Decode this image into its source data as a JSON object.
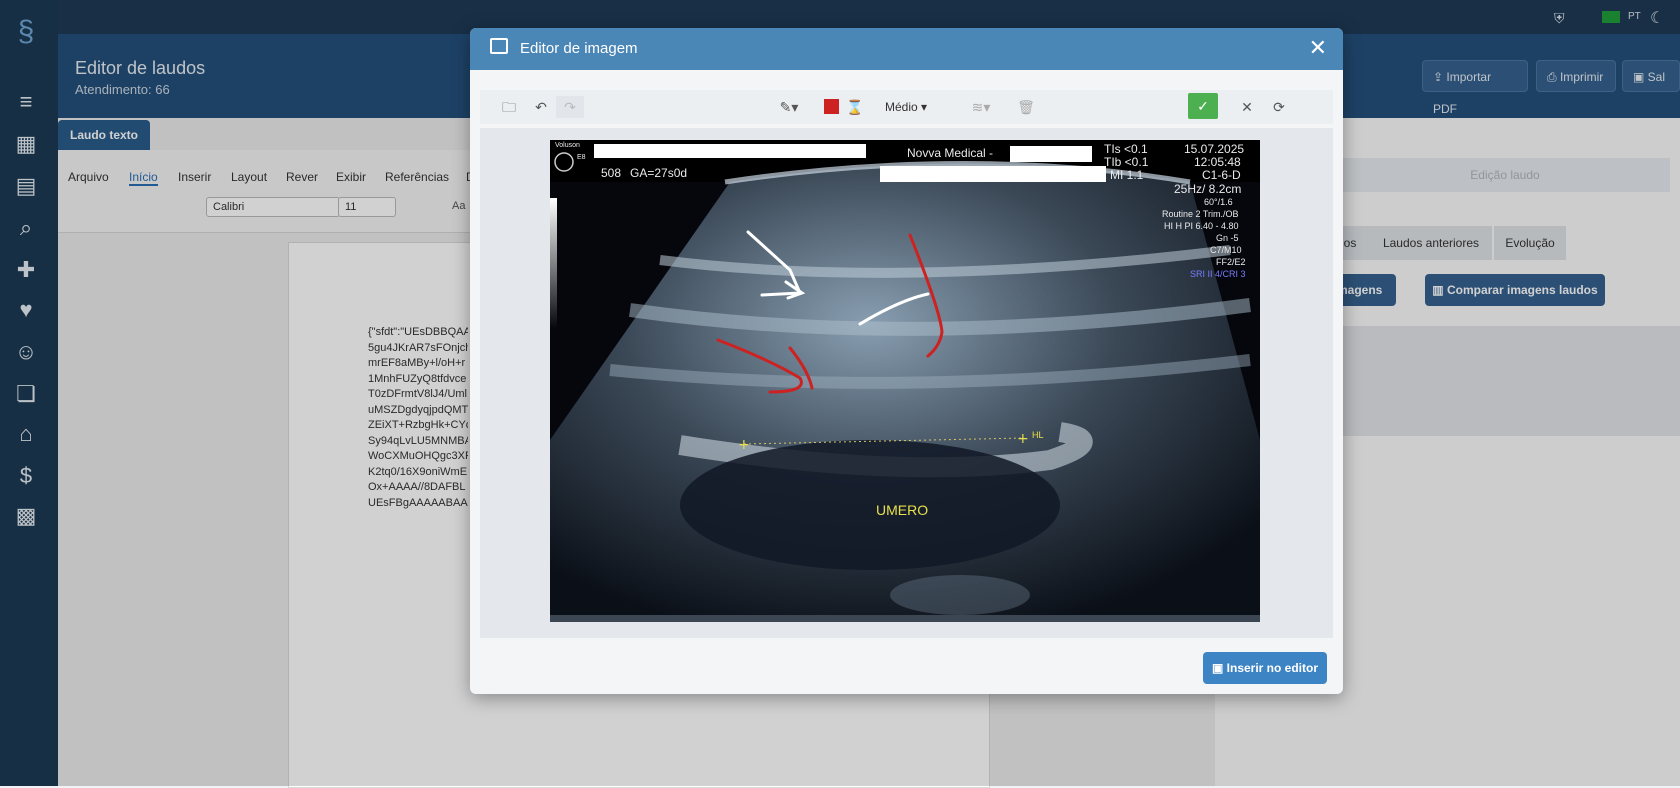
{
  "app": {
    "title": "Editor de laudos",
    "subtitle": "Atendimento: 66",
    "language": "PT",
    "buttons": {
      "import_pdf": "Importar PDF",
      "print": "Imprimir",
      "save": "Sal"
    }
  },
  "editor": {
    "tab_label": "Laudo texto",
    "ribbon_tabs": [
      "Arquivo",
      "Início",
      "Inserir",
      "Layout",
      "Rever",
      "Exibir",
      "Referências",
      "D"
    ],
    "font_name": "Calibri",
    "font_size": "11",
    "aa_label": "Aa",
    "doc_lines": [
      "{\"sfdt\":\"UEsDBBQAA",
      "5gu4JKrAR7sFOnjch",
      "mrEF8aMBy+l/oH+r",
      "1MnhFUZyQ8tfdvce",
      "T0zDFrmtV8lJ4/Uml",
      "uMSZDgdyqjpdQMT",
      "ZEiXT+RzbgHk+CYcI",
      "Sy94qLvLU5MNMBA",
      "WoCXMuOHQgc3XF",
      "K2tq0/16X9oniWmE",
      "Ox+AAAA//8DAFBL",
      "UEsFBgAAAAABAAE"
    ]
  },
  "right_panel": {
    "edit_label": "Edição laudo",
    "tabs": [
      "os",
      "Laudos anteriores",
      "Evolução"
    ],
    "buttons": {
      "images": "imagens",
      "compare": "Comparar imagens laudos"
    }
  },
  "modal": {
    "title": "Editor de imagem",
    "stroke_size": "Médio",
    "insert_label": "Inserir no editor",
    "accent": "#4a86b6",
    "pen_color": "#cc2222",
    "confirm_color": "#4caf50"
  },
  "ultrasound": {
    "clinic": "Novva Medical -",
    "patient_code": "508",
    "ga": "GA=27s0d",
    "tis": "TIs <0.1",
    "tib": "TIb <0.1",
    "mi": "MI  1.1",
    "date": "15.07.2025",
    "time": "12:05:48",
    "probe": "C1-6-D",
    "freq_depth": "25Hz/ 8.2cm",
    "angle": "60°/1.6",
    "preset": "Routine 2 Trim./OB",
    "mode": "HI H PI 6.40 - 4.80",
    "gain": "Gn  -5",
    "c_m": "C7/M10",
    "ff": "FF2/E2",
    "sri": "SRI II 4/CRI 3",
    "voluson": "Voluson",
    "e8": "E8",
    "marker": "HL",
    "structure_label": "UMERO"
  }
}
